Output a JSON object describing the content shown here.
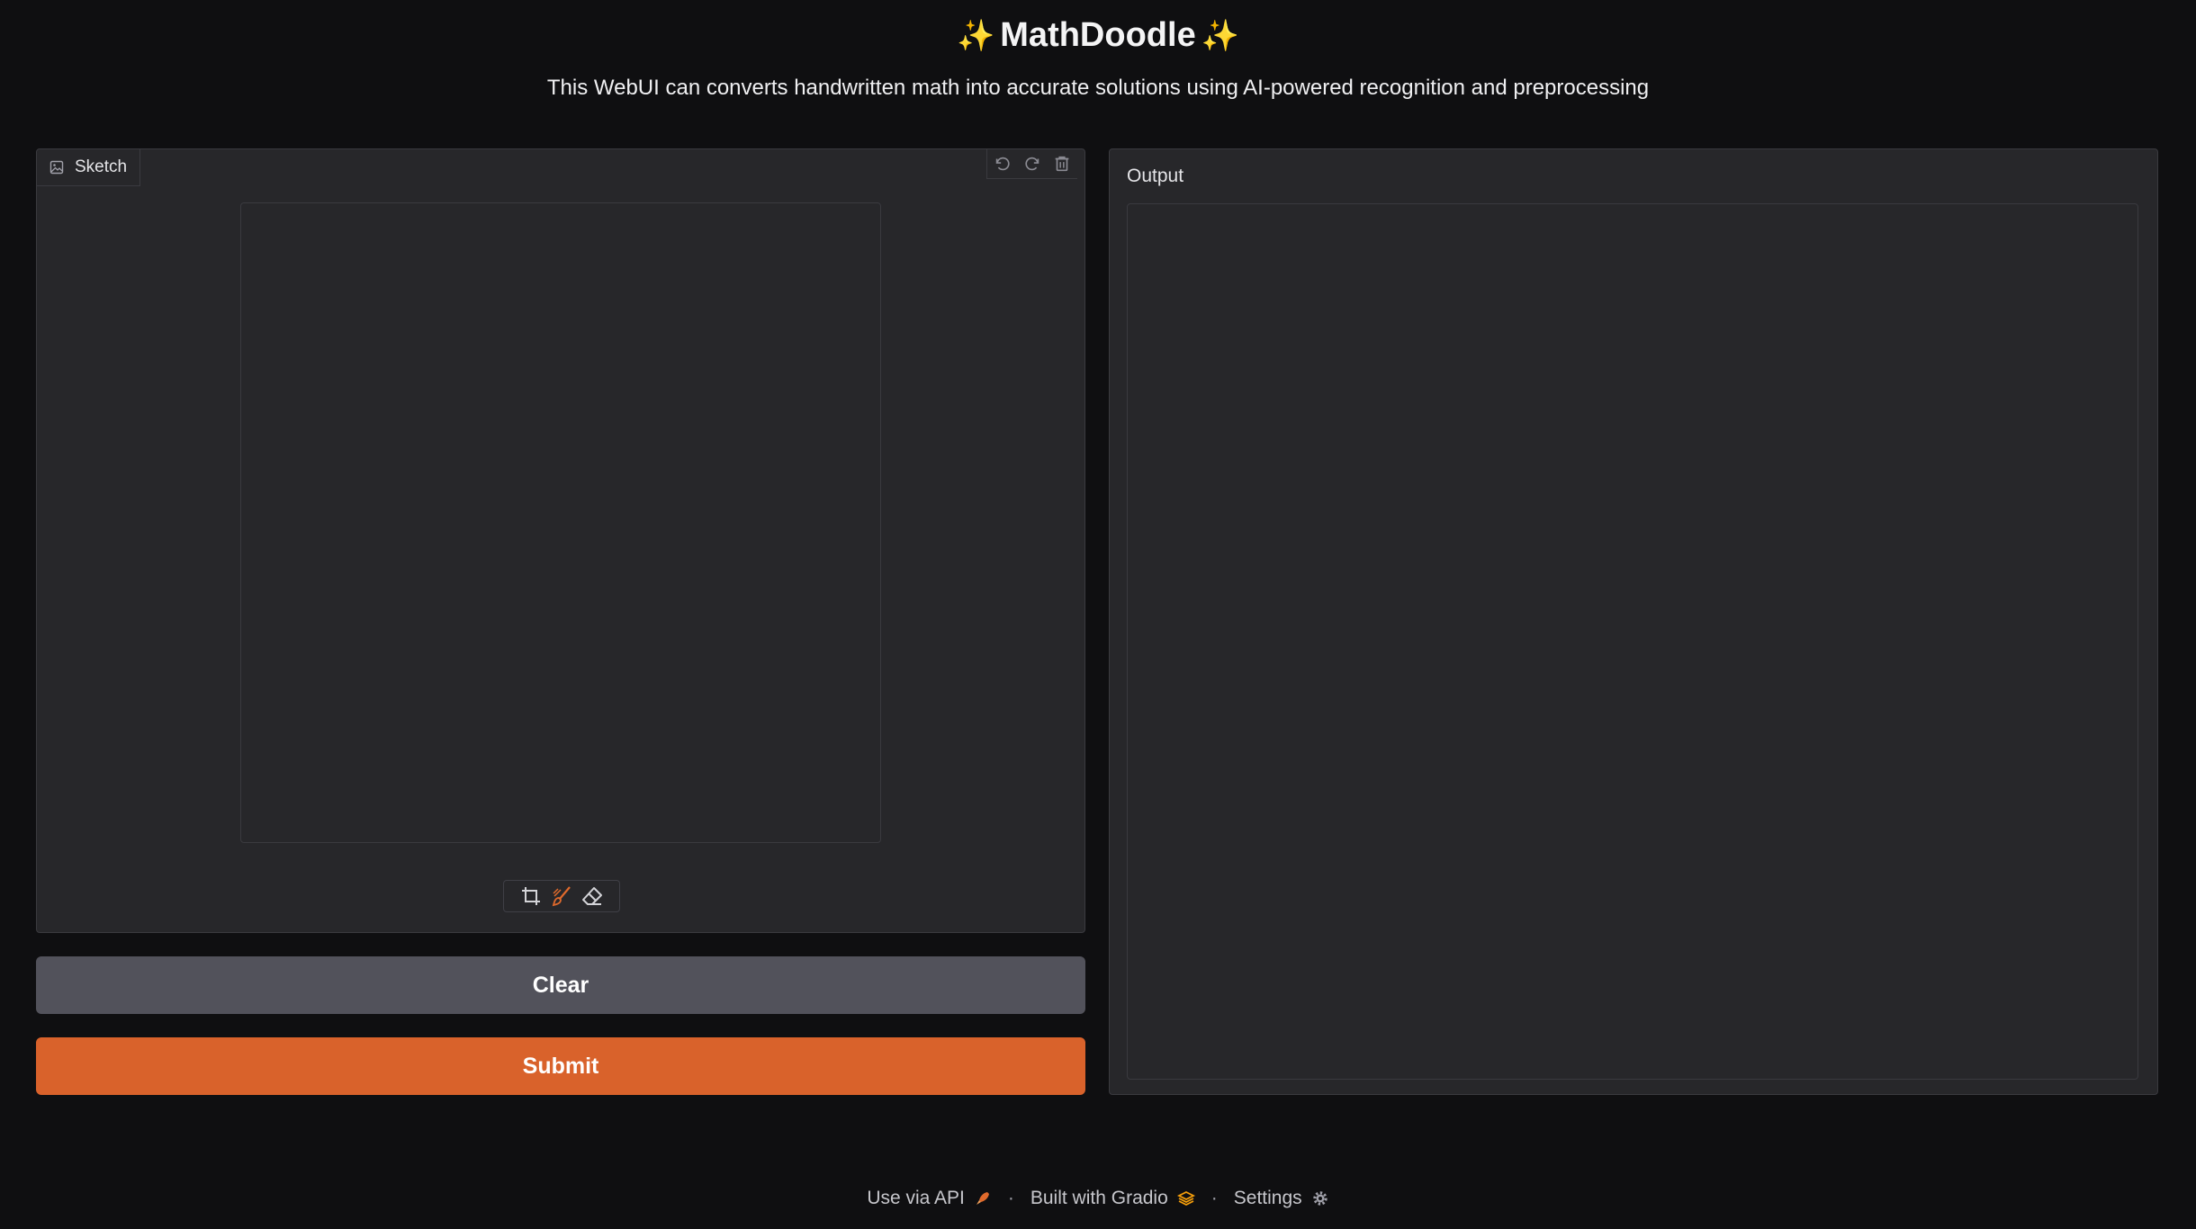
{
  "header": {
    "title": "MathDoodle",
    "sparkle": "✨",
    "subtitle": "This WebUI can converts handwritten math into accurate solutions using AI-powered recognition and preprocessing"
  },
  "sketch": {
    "tab_label": "Sketch",
    "top_tools": [
      "undo-icon",
      "redo-icon",
      "trash-icon"
    ],
    "bottom_tools": [
      "crop-icon",
      "brush-icon",
      "eraser-icon"
    ],
    "active_tool": "brush-icon"
  },
  "buttons": {
    "clear": "Clear",
    "submit": "Submit"
  },
  "output": {
    "label": "Output"
  },
  "footer": {
    "api": "Use via API",
    "built": "Built with Gradio",
    "settings": "Settings",
    "separator": "·"
  },
  "colors": {
    "background": "#0f0f11",
    "panel": "#27272a",
    "accent": "#d9622b",
    "secondary_button": "#52525b"
  }
}
